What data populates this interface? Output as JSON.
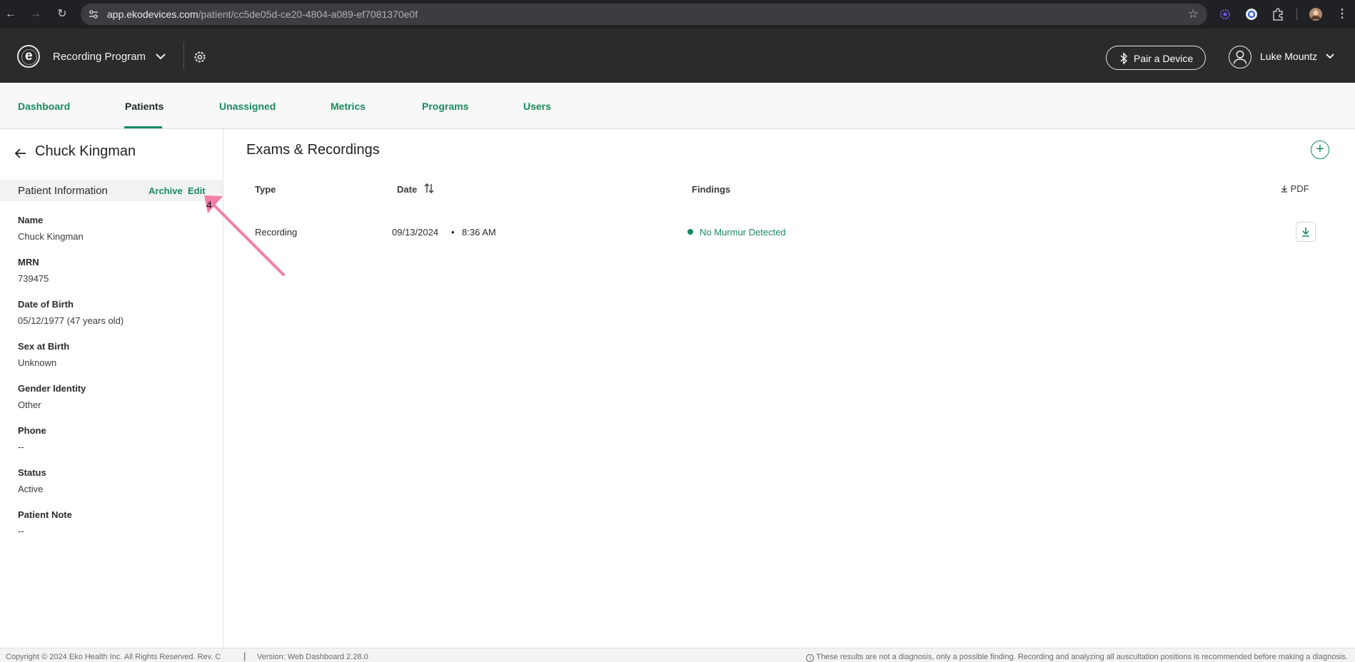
{
  "browser": {
    "url_host": "app.ekodevices.com",
    "url_path": "/patient/cc5de05d-ce20-4804-a089-ef7081370e0f",
    "back_icon": "back-arrow-icon",
    "forward_icon": "forward-arrow-icon",
    "reload_icon": "reload-icon",
    "bookmark_icon": "star-icon"
  },
  "header": {
    "logo_letter": "e",
    "program_name": "Recording Program",
    "pair_button_label": "Pair a Device",
    "user_name": "Luke Mountz"
  },
  "tabs": [
    {
      "label": "Dashboard",
      "active": false
    },
    {
      "label": "Patients",
      "active": true
    },
    {
      "label": "Unassigned",
      "active": false
    },
    {
      "label": "Metrics",
      "active": false
    },
    {
      "label": "Programs",
      "active": false
    },
    {
      "label": "Users",
      "active": false
    }
  ],
  "patient": {
    "title": "Chuck Kingman",
    "info_title": "Patient Information",
    "archive_label": "Archive",
    "edit_label": "Edit",
    "fields": [
      {
        "label": "Name",
        "value": "Chuck Kingman"
      },
      {
        "label": "MRN",
        "value": "739475"
      },
      {
        "label": "Date of Birth",
        "value": "05/12/1977 (47 years old)"
      },
      {
        "label": "Sex at Birth",
        "value": "Unknown"
      },
      {
        "label": "Gender Identity",
        "value": "Other"
      },
      {
        "label": "Phone",
        "value": "--"
      },
      {
        "label": "Status",
        "value": "Active"
      },
      {
        "label": "Patient Note",
        "value": "--"
      }
    ]
  },
  "exams": {
    "title": "Exams & Recordings",
    "add_symbol": "+",
    "columns": {
      "type": "Type",
      "date": "Date",
      "findings": "Findings",
      "pdf": "PDF"
    },
    "rows": [
      {
        "type": "Recording",
        "date": "09/13/2024",
        "time": "8:36 AM",
        "finding": "No Murmur Detected"
      }
    ]
  },
  "annotation": {
    "label": "4",
    "color": "#f07fa8"
  },
  "footer": {
    "copyright": "Copyright © 2024 Eko Health Inc. All Rights Reserved. Rev. C",
    "separator": "|",
    "version": "Version: Web Dashboard 2.28.0",
    "disclaimer": "These results are not a diagnosis, only a possible finding. Recording and analyzing all auscultation positions is recommended before making a diagnosis."
  },
  "colors": {
    "accent": "#1a8a5e",
    "header_bg": "#2b2b2b"
  }
}
